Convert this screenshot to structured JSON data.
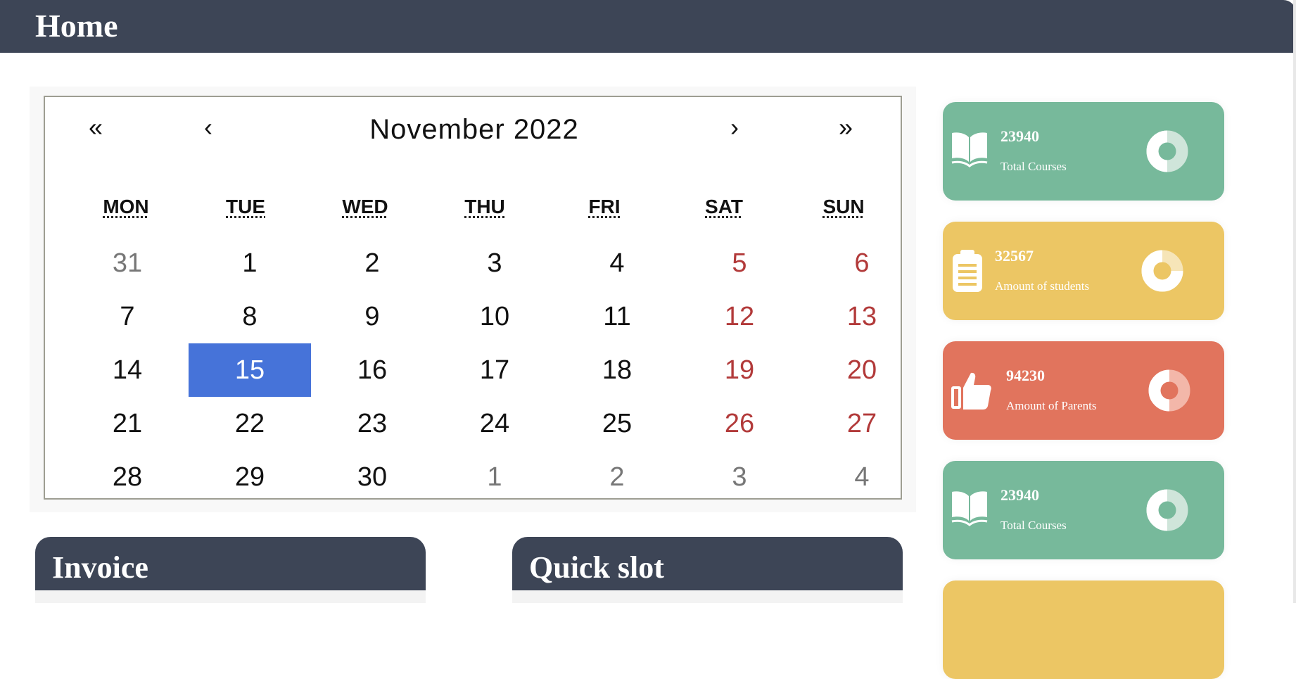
{
  "header": {
    "title": "Home"
  },
  "calendar": {
    "nav": {
      "prev_year": "«",
      "prev_month": "‹",
      "next_month": "›",
      "next_year": "»"
    },
    "month_label": "November 2022",
    "weekdays": [
      "MON",
      "TUE",
      "WED",
      "THU",
      "FRI",
      "SAT",
      "SUN"
    ],
    "weeks": [
      [
        {
          "d": "31",
          "t": "other"
        },
        {
          "d": "1",
          "t": ""
        },
        {
          "d": "2",
          "t": ""
        },
        {
          "d": "3",
          "t": ""
        },
        {
          "d": "4",
          "t": ""
        },
        {
          "d": "5",
          "t": "weekend"
        },
        {
          "d": "6",
          "t": "weekend"
        }
      ],
      [
        {
          "d": "7",
          "t": ""
        },
        {
          "d": "8",
          "t": ""
        },
        {
          "d": "9",
          "t": ""
        },
        {
          "d": "10",
          "t": ""
        },
        {
          "d": "11",
          "t": ""
        },
        {
          "d": "12",
          "t": "weekend"
        },
        {
          "d": "13",
          "t": "weekend"
        }
      ],
      [
        {
          "d": "14",
          "t": ""
        },
        {
          "d": "15",
          "t": "selected"
        },
        {
          "d": "16",
          "t": ""
        },
        {
          "d": "17",
          "t": ""
        },
        {
          "d": "18",
          "t": ""
        },
        {
          "d": "19",
          "t": "weekend"
        },
        {
          "d": "20",
          "t": "weekend"
        }
      ],
      [
        {
          "d": "21",
          "t": ""
        },
        {
          "d": "22",
          "t": ""
        },
        {
          "d": "23",
          "t": ""
        },
        {
          "d": "24",
          "t": ""
        },
        {
          "d": "25",
          "t": ""
        },
        {
          "d": "26",
          "t": "weekend"
        },
        {
          "d": "27",
          "t": "weekend"
        }
      ],
      [
        {
          "d": "28",
          "t": ""
        },
        {
          "d": "29",
          "t": ""
        },
        {
          "d": "30",
          "t": ""
        },
        {
          "d": "1",
          "t": "other"
        },
        {
          "d": "2",
          "t": "other"
        },
        {
          "d": "3",
          "t": "other"
        },
        {
          "d": "4",
          "t": "other"
        }
      ]
    ],
    "selected_color": "#4673d9"
  },
  "panels": {
    "invoice": {
      "title": "Invoice"
    },
    "quick_slot": {
      "title": "Quick slot"
    }
  },
  "stats": [
    {
      "number": "23940",
      "label": "Total Courses",
      "icon": "book-icon",
      "color": "#77b99b"
    },
    {
      "number": "32567",
      "label": "Amount of students",
      "icon": "clipboard-icon",
      "color": "#ecc664"
    },
    {
      "number": "94230",
      "label": "Amount of Parents",
      "icon": "thumbs-up-icon",
      "color": "#e1745d"
    },
    {
      "number": "23940",
      "label": "Total Courses",
      "icon": "book-icon",
      "color": "#77b99b"
    }
  ],
  "colors": {
    "header": "#3d4556",
    "weekend": "#b23a3a"
  }
}
